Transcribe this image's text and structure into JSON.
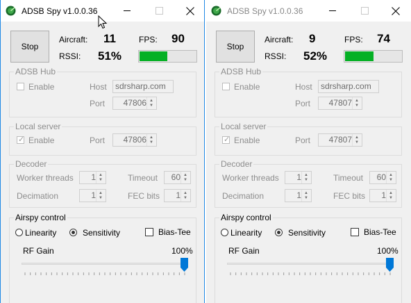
{
  "windows": [
    {
      "title": "ADSB Spy v1.0.0.36",
      "stop_label": "Stop",
      "aircraft_label": "Aircraft:",
      "aircraft_value": "11",
      "fps_label": "FPS:",
      "fps_value": "90",
      "rssi_label": "RSSI:",
      "rssi_value": "51%",
      "rssi_level": 0.51,
      "adsb_hub": {
        "title": "ADSB Hub",
        "enable_label": "Enable",
        "host_label": "Host",
        "host_value": "sdrsharp.com",
        "port_label": "Port",
        "port_value": "47806"
      },
      "local_server": {
        "title": "Local server",
        "enable_label": "Enable",
        "port_label": "Port",
        "port_value": "47806"
      },
      "decoder": {
        "title": "Decoder",
        "worker_threads_label": "Worker threads",
        "worker_threads_value": "1",
        "timeout_label": "Timeout",
        "timeout_value": "60",
        "decimation_label": "Decimation",
        "decimation_value": "1",
        "fec_bits_label": "FEC bits",
        "fec_bits_value": "1"
      },
      "airspy": {
        "title": "Airspy control",
        "linearity_label": "Linearity",
        "sensitivity_label": "Sensitivity",
        "bias_tee_label": "Bias-Tee",
        "rf_gain_label": "RF Gain",
        "rf_gain_value": "100%",
        "rf_gain_level": 1.0
      }
    },
    {
      "title": "ADSB Spy v1.0.0.36",
      "stop_label": "Stop",
      "aircraft_label": "Aircraft:",
      "aircraft_value": "9",
      "fps_label": "FPS:",
      "fps_value": "74",
      "rssi_label": "RSSI:",
      "rssi_value": "52%",
      "rssi_level": 0.52,
      "adsb_hub": {
        "title": "ADSB Hub",
        "enable_label": "Enable",
        "host_label": "Host",
        "host_value": "sdrsharp.com",
        "port_label": "Port",
        "port_value": "47807"
      },
      "local_server": {
        "title": "Local server",
        "enable_label": "Enable",
        "port_label": "Port",
        "port_value": "47807"
      },
      "decoder": {
        "title": "Decoder",
        "worker_threads_label": "Worker threads",
        "worker_threads_value": "1",
        "timeout_label": "Timeout",
        "timeout_value": "60",
        "decimation_label": "Decimation",
        "decimation_value": "1",
        "fec_bits_label": "FEC bits",
        "fec_bits_value": "1"
      },
      "airspy": {
        "title": "Airspy control",
        "linearity_label": "Linearity",
        "sensitivity_label": "Sensitivity",
        "bias_tee_label": "Bias-Tee",
        "rf_gain_label": "RF Gain",
        "rf_gain_value": "100%",
        "rf_gain_level": 1.0
      }
    }
  ],
  "colors": {
    "rssi_fill": "#06b025",
    "slider_thumb": "#0078d7",
    "active_border": "#1e88e5"
  },
  "icons": {
    "app": "adsb-radar-icon",
    "minimize": "minimize-icon",
    "maximize": "maximize-icon",
    "close": "close-icon",
    "cursor": "mouse-cursor-icon"
  }
}
